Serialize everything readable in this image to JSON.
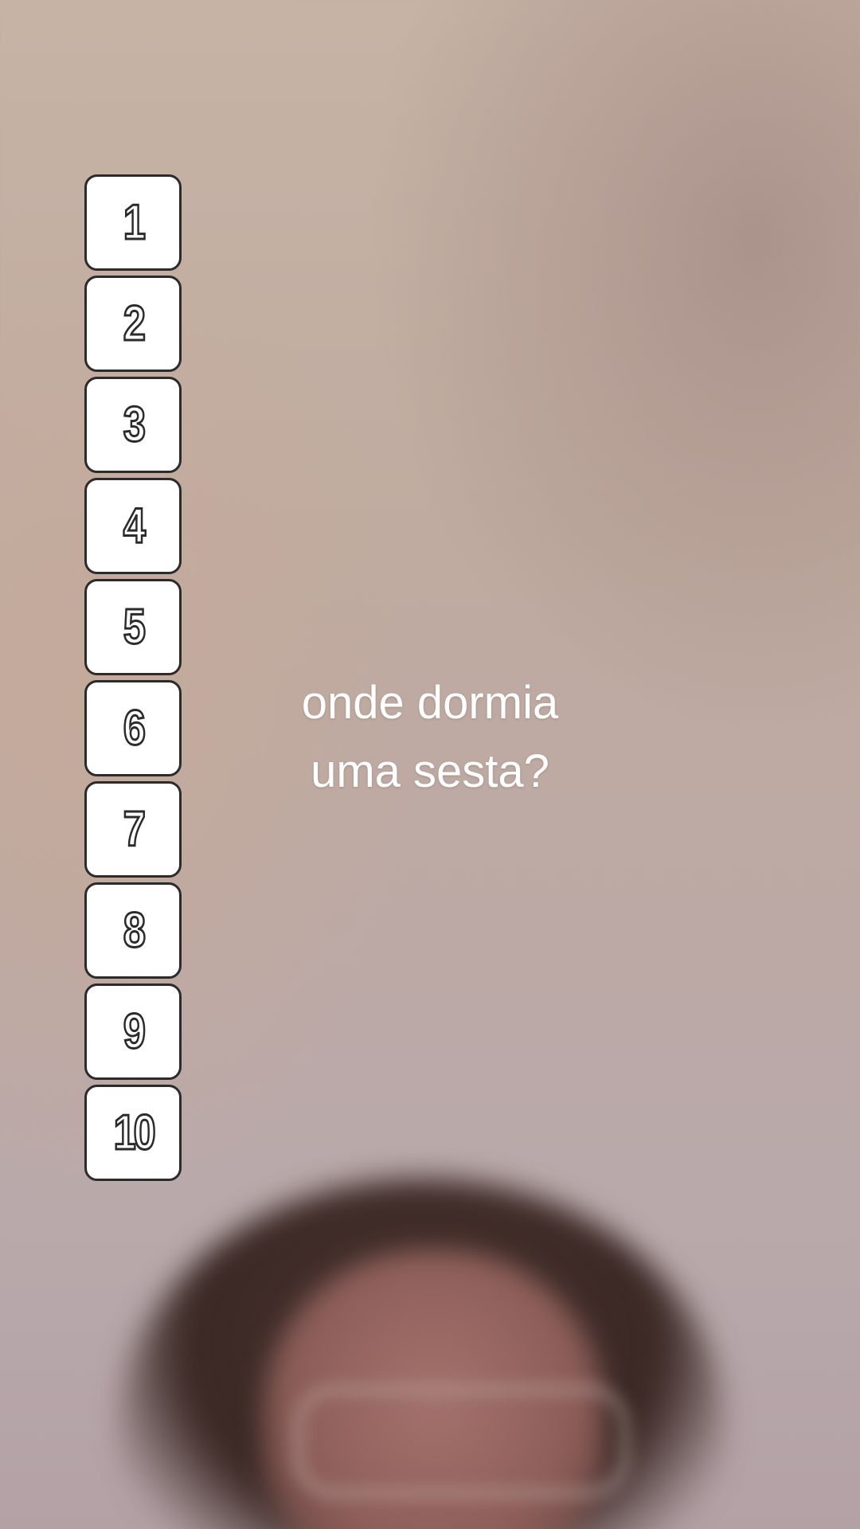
{
  "list": {
    "items": [
      "1",
      "2",
      "3",
      "4",
      "5",
      "6",
      "7",
      "8",
      "9",
      "10"
    ]
  },
  "caption": {
    "line1": "onde dormia",
    "line2": "uma sesta?"
  }
}
